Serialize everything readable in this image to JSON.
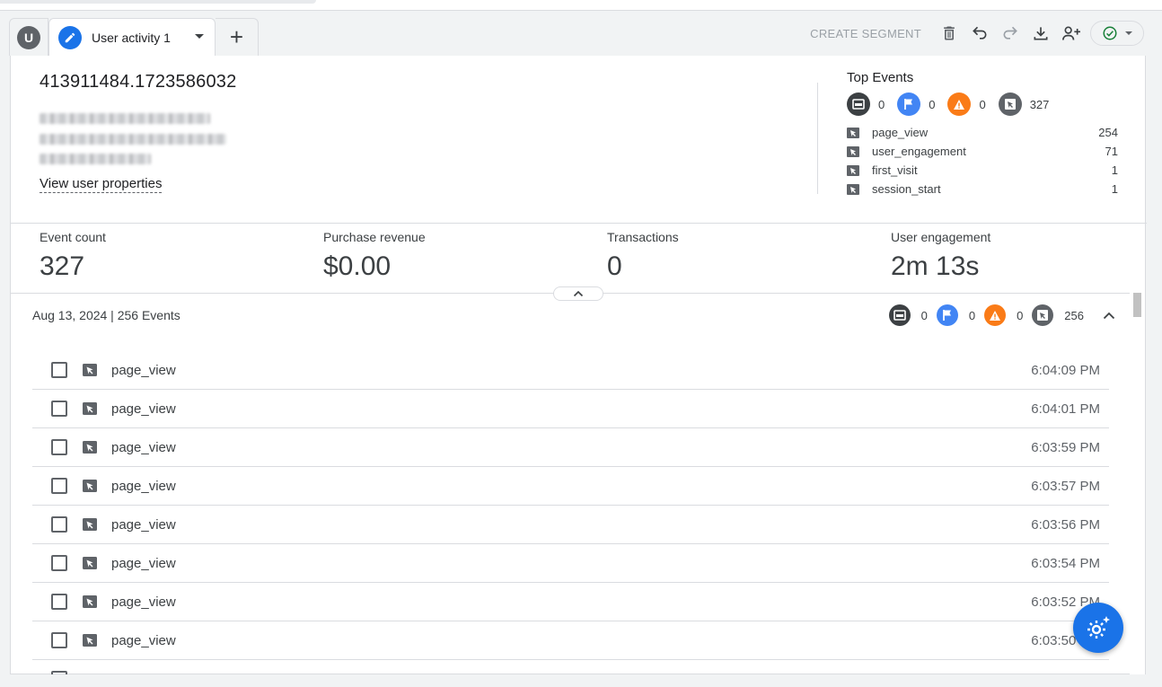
{
  "tabs": {
    "avatar_letter": "U",
    "active_label": "User activity 1",
    "add_label": "+"
  },
  "toolbar": {
    "create_segment": "CREATE SEGMENT"
  },
  "user": {
    "id": "413911484.1723586032",
    "view_properties": "View user properties"
  },
  "top_events": {
    "title": "Top Events",
    "counts": [
      {
        "kind": "page-icon",
        "value": "0",
        "color": "#3c4043"
      },
      {
        "kind": "flag-icon",
        "value": "0",
        "color": "#4285f4"
      },
      {
        "kind": "warning-icon",
        "value": "0",
        "color": "#fa7b17"
      },
      {
        "kind": "cursor-icon",
        "value": "327",
        "color": "#5f6368"
      }
    ],
    "items": [
      {
        "name": "page_view",
        "count": "254"
      },
      {
        "name": "user_engagement",
        "count": "71"
      },
      {
        "name": "first_visit",
        "count": "1"
      },
      {
        "name": "session_start",
        "count": "1"
      }
    ]
  },
  "metrics": [
    {
      "label": "Event count",
      "value": "327"
    },
    {
      "label": "Purchase revenue",
      "value": "$0.00"
    },
    {
      "label": "Transactions",
      "value": "0"
    },
    {
      "label": "User engagement",
      "value": "2m 13s"
    }
  ],
  "day": {
    "header": "Aug 13, 2024 | 256 Events",
    "counts": [
      "0",
      "0",
      "0",
      "256"
    ]
  },
  "events": [
    {
      "name": "page_view",
      "time": "6:04:09 PM"
    },
    {
      "name": "page_view",
      "time": "6:04:01 PM"
    },
    {
      "name": "page_view",
      "time": "6:03:59 PM"
    },
    {
      "name": "page_view",
      "time": "6:03:57 PM"
    },
    {
      "name": "page_view",
      "time": "6:03:56 PM"
    },
    {
      "name": "page_view",
      "time": "6:03:54 PM"
    },
    {
      "name": "page_view",
      "time": "6:03:52 PM"
    },
    {
      "name": "page_view",
      "time": "6:03:50 PM"
    }
  ],
  "colors": {
    "accent": "#1a73e8",
    "page": "#3c4043",
    "flag": "#4285f4",
    "warning": "#fa7b17",
    "cursor": "#5f6368"
  }
}
